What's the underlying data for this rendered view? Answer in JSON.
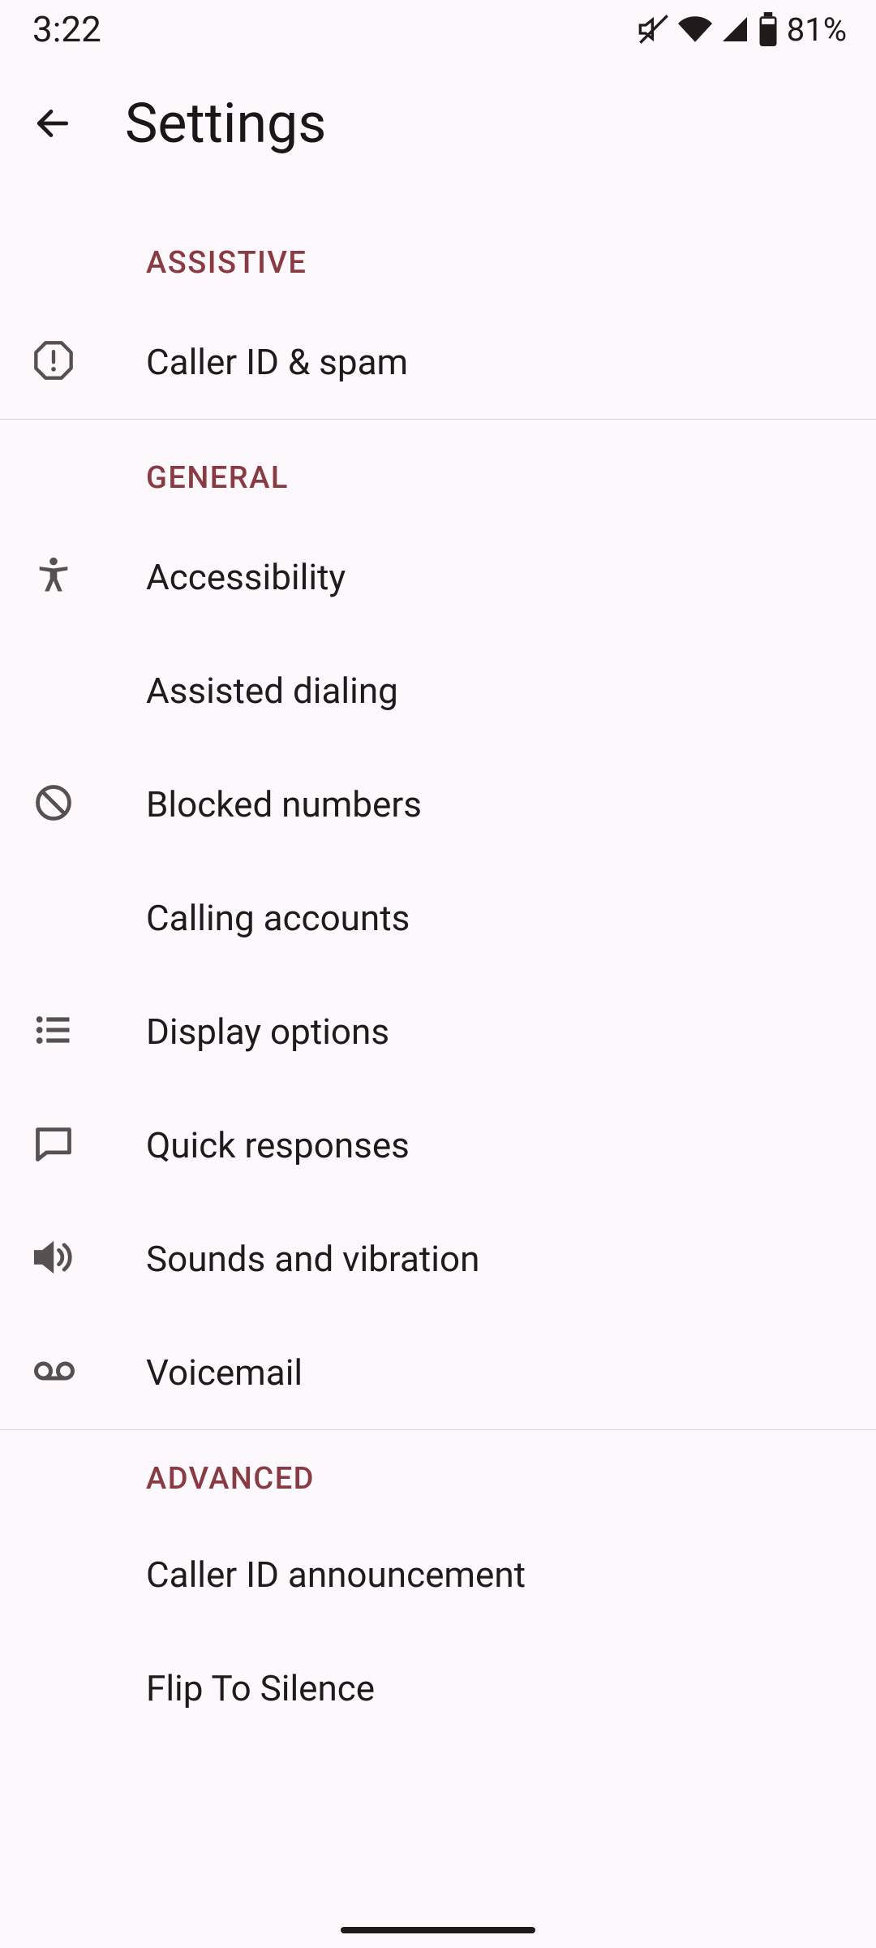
{
  "status_bar": {
    "time": "3:22",
    "battery_text": "81%"
  },
  "app_bar": {
    "title": "Settings"
  },
  "sections": {
    "assistive": {
      "header": "ASSISTIVE",
      "items": [
        {
          "label": "Caller ID & spam"
        }
      ]
    },
    "general": {
      "header": "GENERAL",
      "items": [
        {
          "label": "Accessibility"
        },
        {
          "label": "Assisted dialing"
        },
        {
          "label": "Blocked numbers"
        },
        {
          "label": "Calling accounts"
        },
        {
          "label": "Display options"
        },
        {
          "label": "Quick responses"
        },
        {
          "label": "Sounds and vibration"
        },
        {
          "label": "Voicemail"
        }
      ]
    },
    "advanced": {
      "header": "ADVANCED",
      "items": [
        {
          "label": "Caller ID announcement"
        },
        {
          "label": "Flip To Silence"
        }
      ]
    }
  }
}
